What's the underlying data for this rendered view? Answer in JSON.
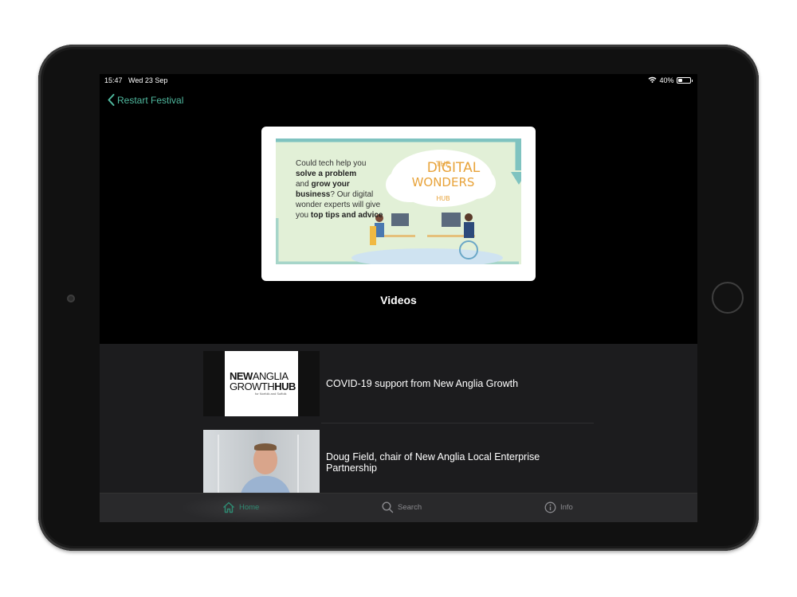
{
  "status_bar": {
    "time": "15:47",
    "date": "Wed 23 Sep",
    "battery_text": "40%",
    "battery_level": 0.4
  },
  "nav": {
    "back_label": "Restart Festival"
  },
  "hero": {
    "line1": "Could tech help you",
    "bold1": "solve a problem",
    "line2": "and",
    "bold2": "grow your",
    "bold3": "business",
    "line3": "? Our digital wonder experts will give you",
    "bold4": "top tips and advice",
    "logo_top": "THE",
    "logo_main1": "DIGITAL",
    "logo_main2": "WONDERS",
    "logo_sub": "HUB"
  },
  "section_title": "Videos",
  "videos": [
    {
      "title": "COVID-19 support from New Anglia Growth",
      "thumb_line1_a": "NEW",
      "thumb_line1_b": "ANGLIA",
      "thumb_line2_a": "GROWTH",
      "thumb_line2_b": "HUB",
      "thumb_sub": "for Norfolk and Suffolk"
    },
    {
      "title": "Doug Field, chair of New Anglia Local Enterprise Partnership"
    }
  ],
  "tabs": [
    {
      "label": "Home",
      "icon": "home-icon",
      "active": true
    },
    {
      "label": "Search",
      "icon": "search-icon",
      "active": false
    },
    {
      "label": "Info",
      "icon": "info-icon",
      "active": false
    }
  ],
  "colors": {
    "accent": "#4fb89e",
    "tab_active": "#2f8a72",
    "list_bg": "#1c1c1e",
    "tab_bg": "#29292b"
  }
}
